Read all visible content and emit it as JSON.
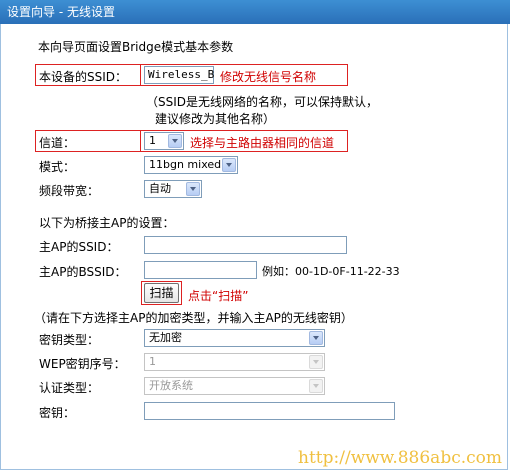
{
  "window": {
    "title": "设置向导 - 无线设置"
  },
  "intro": "本向导页面设置Bridge模式基本参数",
  "ssid": {
    "label": "本设备的SSID：",
    "value": "Wireless_B",
    "annotation": "修改无线信号名称",
    "note_line1": "（SSID是无线网络的名称，可以保持默认，",
    "note_line2": "建议修改为其他名称）"
  },
  "channel": {
    "label": "信道：",
    "value": "1",
    "annotation": "选择与主路由器相同的信道"
  },
  "mode": {
    "label": "模式：",
    "value": "11bgn mixed"
  },
  "bandwidth": {
    "label": "频段带宽：",
    "value": "自动"
  },
  "bridge_section": {
    "heading": "以下为桥接主AP的设置："
  },
  "ap_ssid": {
    "label": "主AP的SSID：",
    "value": ""
  },
  "ap_bssid": {
    "label": "主AP的BSSID：",
    "value": "",
    "example": "例如：00-1D-0F-11-22-33"
  },
  "scan": {
    "label": "扫描",
    "annotation": "点击“扫描”"
  },
  "encryption_note": "（请在下方选择主AP的加密类型，并输入主AP的无线密钥）",
  "key_type": {
    "label": "密钥类型：",
    "value": "无加密"
  },
  "wep_index": {
    "label": "WEP密钥序号：",
    "value": "1"
  },
  "auth_type": {
    "label": "认证类型：",
    "value": "开放系统"
  },
  "key": {
    "label": "密钥：",
    "value": ""
  },
  "watermark": "http://www.886abc.com",
  "colors": {
    "titlebar": "#2f7cc6",
    "annotation_red": "#d00000",
    "highlight_box": "#dd2222"
  }
}
